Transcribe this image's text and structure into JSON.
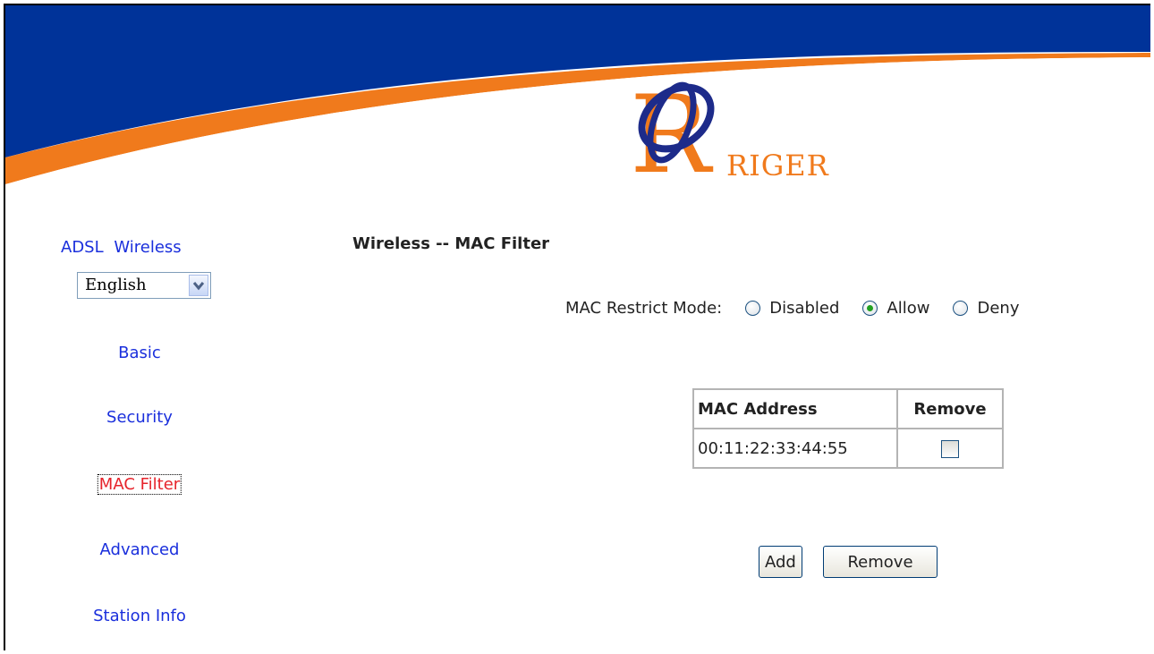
{
  "brand": {
    "name": "RIGER"
  },
  "nav": {
    "language_title": "ADSL  Wireless",
    "language_selected": "English",
    "items": [
      {
        "label": "Basic",
        "active": false
      },
      {
        "label": "Security",
        "active": false
      },
      {
        "label": "MAC Filter",
        "active": true
      },
      {
        "label": "Advanced",
        "active": false
      },
      {
        "label": "Station Info",
        "active": false
      }
    ]
  },
  "content": {
    "title": "Wireless -- MAC Filter",
    "mode_label": "MAC Restrict Mode:",
    "modes": [
      {
        "label": "Disabled",
        "checked": false
      },
      {
        "label": "Allow",
        "checked": true
      },
      {
        "label": "Deny",
        "checked": false
      }
    ],
    "table": {
      "headers": [
        "MAC Address",
        "Remove"
      ],
      "rows": [
        {
          "mac": "00:11:22:33:44:55",
          "remove_checked": false
        }
      ]
    },
    "buttons": {
      "add": "Add",
      "remove": "Remove"
    }
  },
  "colors": {
    "banner_blue": "#003399",
    "banner_orange": "#f07a1c",
    "link": "#1a2fdc",
    "active_link": "#e6232b"
  }
}
